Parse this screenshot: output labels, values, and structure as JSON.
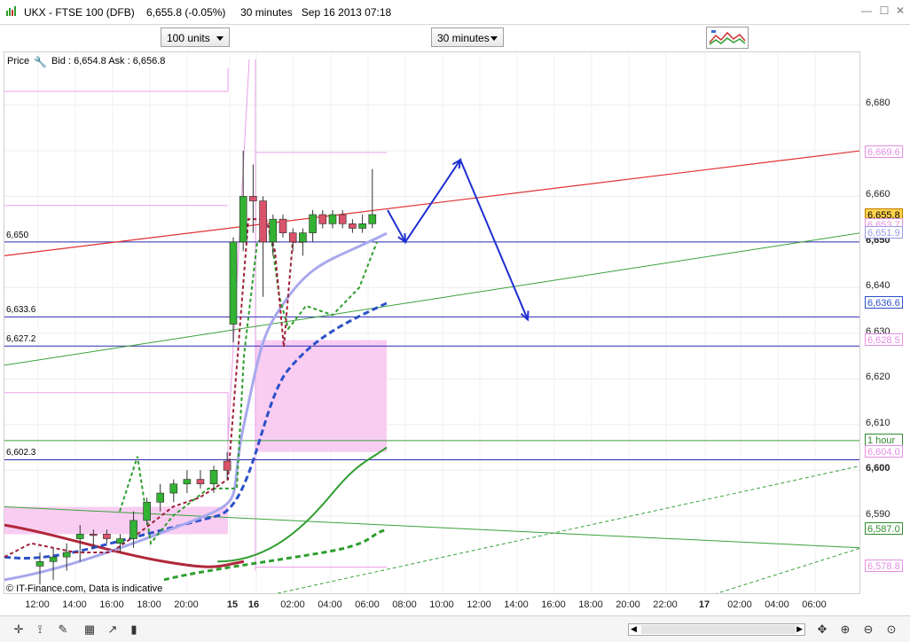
{
  "window": {
    "title": "UKX - FTSE 100 (DFB)    6,655.8 (-0.05%)     30 minutes   Sep 16 2013 07:18",
    "minimize": "—",
    "maximize": "☐",
    "close": "✕"
  },
  "toolbar": {
    "size_select": "100 units",
    "interval_select": "30 minutes"
  },
  "chart_header": {
    "price_label": "Price",
    "bid_ask": "Bid : 6,654.8 Ask : 6,656.8"
  },
  "horizontal_levels": [
    {
      "label": "6,650",
      "value": 6650,
      "color": "#2b2bb0"
    },
    {
      "label": "6,633.6",
      "value": 6633.6,
      "color": "#2b2bb0"
    },
    {
      "label": "6,627.2",
      "value": 6627.2,
      "color": "#2b2bb0"
    },
    {
      "label": "6,602.3",
      "value": 6602.3,
      "color": "#2b2bb0"
    }
  ],
  "footer_note": "© IT-Finance.com, Data is indicative",
  "y_axis": {
    "ticks": [
      "6,680",
      "6,660",
      "6,650",
      "6,640",
      "6,630",
      "6,620",
      "6,610",
      "6,600",
      "6,590"
    ],
    "badges": [
      {
        "text": "6,669.6",
        "value": 6669.6,
        "color": "#e48ee4",
        "bg": "#ffffff"
      },
      {
        "text": "6,655.8",
        "value": 6655.8,
        "color": "#c08000",
        "bg": "#ffd24d"
      },
      {
        "text": "6,653.7",
        "value": 6653.7,
        "color": "#e48ee4",
        "bg": "#ffffff"
      },
      {
        "text": "6,651.9",
        "value": 6651.9,
        "color": "#9a9ae6",
        "bg": "#ffffff"
      },
      {
        "text": "6,636.6",
        "value": 6636.6,
        "color": "#2b50c8",
        "bg": "#ffffff"
      },
      {
        "text": "6,628.5",
        "value": 6628.5,
        "color": "#e48ee4",
        "bg": "#ffffff"
      },
      {
        "text": "1 hour",
        "value": 6606.5,
        "color": "#2e8b2e",
        "bg": "#ffffff"
      },
      {
        "text": "6,604.0",
        "value": 6604.0,
        "color": "#e48ee4",
        "bg": "#ffffff"
      },
      {
        "text": "6,587.0",
        "value": 6587.0,
        "color": "#2e8b2e",
        "bg": "#ffffff"
      },
      {
        "text": "6,578.8",
        "value": 6578.8,
        "color": "#e48ee4",
        "bg": "#ffffff"
      }
    ]
  },
  "x_axis": {
    "ticks": [
      {
        "label": "12:00",
        "bold": false
      },
      {
        "label": "14:00",
        "bold": false
      },
      {
        "label": "16:00",
        "bold": false
      },
      {
        "label": "18:00",
        "bold": false
      },
      {
        "label": "20:00",
        "bold": false
      },
      {
        "label": "15",
        "bold": true
      },
      {
        "label": "16",
        "bold": true
      },
      {
        "label": "02:00",
        "bold": false
      },
      {
        "label": "04:00",
        "bold": false
      },
      {
        "label": "06:00",
        "bold": false
      },
      {
        "label": "08:00",
        "bold": false
      },
      {
        "label": "10:00",
        "bold": false
      },
      {
        "label": "12:00",
        "bold": false
      },
      {
        "label": "14:00",
        "bold": false
      },
      {
        "label": "16:00",
        "bold": false
      },
      {
        "label": "18:00",
        "bold": false
      },
      {
        "label": "20:00",
        "bold": false
      },
      {
        "label": "22:00",
        "bold": false
      },
      {
        "label": "17",
        "bold": true
      },
      {
        "label": "02:00",
        "bold": false
      },
      {
        "label": "04:00",
        "bold": false
      },
      {
        "label": "06:00",
        "bold": false
      }
    ]
  },
  "bottom_toolbar": {
    "icons": [
      "crosshair-icon",
      "indicator-icon",
      "draw-tool-icon",
      "layout-icon",
      "trend-icon",
      "chart-type-icon"
    ],
    "zoom_icons": [
      "zoom-in-icon",
      "zoom-out-icon",
      "zoom-reset-icon",
      "scroll-right-icon"
    ]
  },
  "chart_data": {
    "type": "candlestick",
    "instrument": "UKX - FTSE 100 (DFB)",
    "interval": "30 minutes",
    "ylim": [
      6575,
      6690
    ],
    "candles": [
      {
        "o": 6579,
        "h": 6582,
        "l": 6575,
        "c": 6580,
        "bull": true
      },
      {
        "o": 6580,
        "h": 6583,
        "l": 6576,
        "c": 6581,
        "bull": true
      },
      {
        "o": 6581,
        "h": 6584,
        "l": 6578,
        "c": 6582,
        "bull": true
      },
      {
        "o": 6585,
        "h": 6588,
        "l": 6580,
        "c": 6586,
        "bull": true
      },
      {
        "o": 6586,
        "h": 6587,
        "l": 6583,
        "c": 6586,
        "bull": false
      },
      {
        "o": 6586,
        "h": 6587,
        "l": 6584,
        "c": 6585,
        "bull": false
      },
      {
        "o": 6584,
        "h": 6586,
        "l": 6582,
        "c": 6585,
        "bull": true
      },
      {
        "o": 6585,
        "h": 6591,
        "l": 6583,
        "c": 6589,
        "bull": true
      },
      {
        "o": 6589,
        "h": 6594,
        "l": 6588,
        "c": 6593,
        "bull": true
      },
      {
        "o": 6593,
        "h": 6597,
        "l": 6591,
        "c": 6595,
        "bull": true
      },
      {
        "o": 6595,
        "h": 6598,
        "l": 6593,
        "c": 6597,
        "bull": true
      },
      {
        "o": 6597,
        "h": 6600,
        "l": 6595,
        "c": 6598,
        "bull": true
      },
      {
        "o": 6598,
        "h": 6600,
        "l": 6596,
        "c": 6597,
        "bull": false
      },
      {
        "o": 6597,
        "h": 6601,
        "l": 6595,
        "c": 6600,
        "bull": true
      },
      {
        "o": 6600,
        "h": 6604,
        "l": 6598,
        "c": 6602,
        "bull": false
      },
      {
        "o": 6632,
        "h": 6651,
        "l": 6628,
        "c": 6650,
        "bull": true
      },
      {
        "o": 6650,
        "h": 6670,
        "l": 6648,
        "c": 6660,
        "bull": true
      },
      {
        "o": 6660,
        "h": 6667,
        "l": 6652,
        "c": 6659,
        "bull": false
      },
      {
        "o": 6659,
        "h": 6660,
        "l": 6638,
        "c": 6650,
        "bull": false
      },
      {
        "o": 6650,
        "h": 6656,
        "l": 6647,
        "c": 6655,
        "bull": true
      },
      {
        "o": 6655,
        "h": 6656,
        "l": 6651,
        "c": 6652,
        "bull": false
      },
      {
        "o": 6652,
        "h": 6653,
        "l": 6648,
        "c": 6650,
        "bull": false
      },
      {
        "o": 6650,
        "h": 6653,
        "l": 6647,
        "c": 6652,
        "bull": true
      },
      {
        "o": 6652,
        "h": 6657,
        "l": 6650,
        "c": 6656,
        "bull": true
      },
      {
        "o": 6656,
        "h": 6657,
        "l": 6653,
        "c": 6654,
        "bull": false
      },
      {
        "o": 6654,
        "h": 6657,
        "l": 6653,
        "c": 6656,
        "bull": true
      },
      {
        "o": 6656,
        "h": 6657,
        "l": 6653,
        "c": 6654,
        "bull": false
      },
      {
        "o": 6654,
        "h": 6655,
        "l": 6652,
        "c": 6653,
        "bull": false
      },
      {
        "o": 6653,
        "h": 6656,
        "l": 6652,
        "c": 6654,
        "bull": true
      },
      {
        "o": 6654,
        "h": 6666,
        "l": 6653,
        "c": 6656,
        "bull": true
      }
    ],
    "annotations": {
      "arrow_path": [
        6657,
        6650,
        6668,
        6633
      ],
      "resistance_trend": [
        6647,
        6670
      ],
      "support_trend": [
        6623,
        6652
      ]
    },
    "colors": {
      "bull": "#33b233",
      "bear": "#d9536b",
      "arrow": "#1f2fd0",
      "trend_red": "#e03030",
      "trend_green": "#3aa13a",
      "pink_band": "#f9cdf2"
    }
  }
}
